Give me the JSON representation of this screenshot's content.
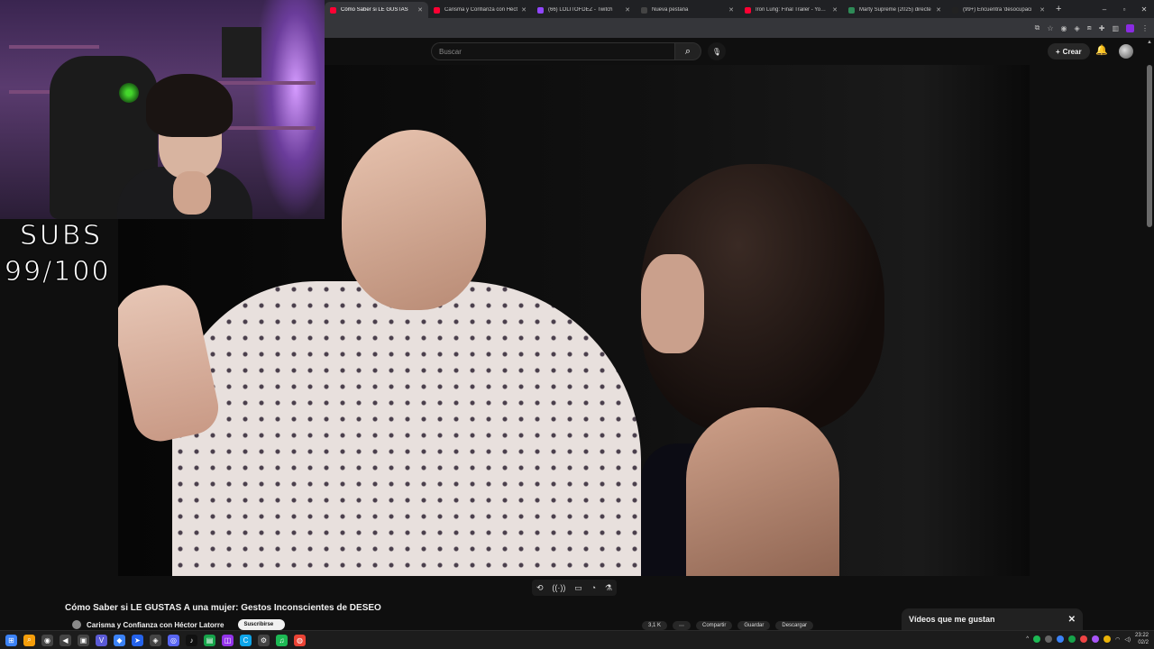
{
  "browser": {
    "tabs": [
      {
        "title": "Cómo Saber si LE GUSTAS",
        "favicon_color": "#ff0033",
        "active": true
      },
      {
        "title": "Carisma y Confianza con Héct",
        "favicon_color": "#ff0033",
        "active": false
      },
      {
        "title": "(66) LOLITOFDEZ - Twitch",
        "favicon_color": "#9146ff",
        "active": false
      },
      {
        "title": "Nueva pestaña",
        "favicon_color": "#444444",
        "active": false
      },
      {
        "title": "Iron Lung: Final Trailer - YouTu",
        "favicon_color": "#ff0033",
        "active": false
      },
      {
        "title": "Marty Supreme (2025) directe",
        "favicon_color": "#2e8b57",
        "active": false
      },
      {
        "title": "(99+) Encuentra 'desocupaci",
        "favicon_color": "#222222",
        "active": false
      }
    ],
    "new_tab_icon": "+",
    "window_controls": [
      "–",
      "▫",
      "✕"
    ]
  },
  "youtube": {
    "search_placeholder": "Buscar",
    "search_icon": "⌕",
    "mic_icon": "🎙",
    "create_label": "Crear",
    "bell_icon": "🔔",
    "video": {
      "title": "Cómo Saber si LE GUSTAS A una mujer: Gestos Inconscientes de DESEO",
      "channel": "Carisma y Confianza con Héctor Latorre",
      "subscribe_label": "Suscribirse",
      "actions": [
        "3,1 K",
        "⋯",
        "Compartir",
        "Guardar",
        "Descargar"
      ]
    },
    "controls_icons": [
      "⟲",
      "((·))",
      "▭",
      "◔",
      "⚗"
    ],
    "liked_panel": {
      "title": "Vídeos que me gustan",
      "close_icon": "✕"
    }
  },
  "overlay": {
    "subs_label": "SUBS",
    "subs_count": "99/100"
  },
  "taskbar": {
    "icons": [
      {
        "name": "start",
        "glyph": "⊞",
        "color": "#3b82f6"
      },
      {
        "name": "search",
        "glyph": "⌕",
        "color": "#f59e0b"
      },
      {
        "name": "app-1",
        "glyph": "◉",
        "color": "#444"
      },
      {
        "name": "app-2",
        "glyph": "◀",
        "color": "#444"
      },
      {
        "name": "app-3",
        "glyph": "▣",
        "color": "#444"
      },
      {
        "name": "app-4",
        "glyph": "V",
        "color": "#5b5bd6"
      },
      {
        "name": "app-5",
        "glyph": "◆",
        "color": "#3b82f6"
      },
      {
        "name": "app-6",
        "glyph": "➤",
        "color": "#2563eb"
      },
      {
        "name": "app-7",
        "glyph": "◈",
        "color": "#444"
      },
      {
        "name": "discord",
        "glyph": "◎",
        "color": "#5865f2"
      },
      {
        "name": "tiktok",
        "glyph": "♪",
        "color": "#111"
      },
      {
        "name": "app-8",
        "glyph": "▤",
        "color": "#16a34a"
      },
      {
        "name": "app-9",
        "glyph": "◫",
        "color": "#9333ea"
      },
      {
        "name": "app-10",
        "glyph": "C",
        "color": "#0ea5e9"
      },
      {
        "name": "app-11",
        "glyph": "⚙",
        "color": "#444"
      },
      {
        "name": "spotify",
        "glyph": "♫",
        "color": "#1db954"
      },
      {
        "name": "chrome",
        "glyph": "◍",
        "color": "#ea4335"
      }
    ],
    "clock_time": "23:22",
    "clock_date": "02/2"
  },
  "colors": {
    "youtube_red": "#ff0033",
    "background": "#0f0f0f",
    "chrome_bar": "#35363a"
  }
}
